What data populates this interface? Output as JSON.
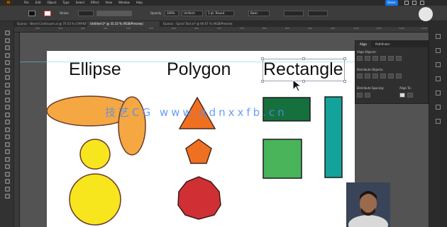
{
  "menubar": {
    "logo": "Ai",
    "items": [
      "File",
      "Edit",
      "Object",
      "Type",
      "Select",
      "Effect",
      "View",
      "Window",
      "Help"
    ],
    "share_label": "Share"
  },
  "controlbar": {
    "stroke_label": "Stroke",
    "opacity_label": "Opacity",
    "opacity_value": "100%",
    "style_label": "Style",
    "brush_value": "Uniform",
    "profile_value": "3 pt. Round",
    "width_value": "Basic"
  },
  "tabs": [
    {
      "label": "Quarac - Blend Continuum.ai @ 70.53 % (CMYK/Preview)",
      "active": false
    },
    {
      "label": "Untitled-2* @ 33.33 % (RGB/Preview)",
      "active": true
    },
    {
      "label": "Quarac - Spiral Tool.ai* @ 66.67 % (RGB/Preview)",
      "active": false
    }
  ],
  "ruler": [
    "300",
    "350",
    "400",
    "450",
    "500",
    "550",
    "600",
    "650",
    "700",
    "750",
    "800",
    "850",
    "900",
    "950",
    "1000",
    "1050",
    "1100",
    "1150"
  ],
  "artboard": {
    "labels": {
      "ellipse": "Ellipse",
      "polygon": "Polygon",
      "rectangle": "Rectangle"
    }
  },
  "shapes": {
    "ellipse_fill": "#f5a742",
    "circle_yellow": "#f7e51e",
    "triangle_fill": "#f07022",
    "pentagon_fill": "#f07022",
    "octagon_fill": "#d03034",
    "rect_dark_green": "#16703e",
    "rect_teal": "#14a39a",
    "square_green": "#49b45a"
  },
  "watermark": "技艺CG  www.qdnxxfb.cn",
  "panel": {
    "tabs": [
      "Align",
      "Pathfinder"
    ],
    "align_objects": "Align Objects:",
    "distribute_objects": "Distribute Objects:",
    "distribute_spacing": "Distribute Spacing:",
    "align_to": "Align To:"
  },
  "icons": {
    "tools": [
      "selection-icon",
      "direct-selection-icon",
      "pen-icon",
      "type-icon",
      "line-icon",
      "rectangle-tool-icon",
      "brush-icon",
      "pencil-icon",
      "eraser-icon",
      "rotate-icon",
      "scale-icon",
      "width-icon",
      "warp-icon",
      "shape-builder-icon",
      "gradient-icon",
      "eyedropper-icon",
      "blend-icon",
      "symbol-icon",
      "graph-icon",
      "artboard-icon",
      "slice-icon",
      "hand-icon",
      "zoom-icon"
    ]
  }
}
